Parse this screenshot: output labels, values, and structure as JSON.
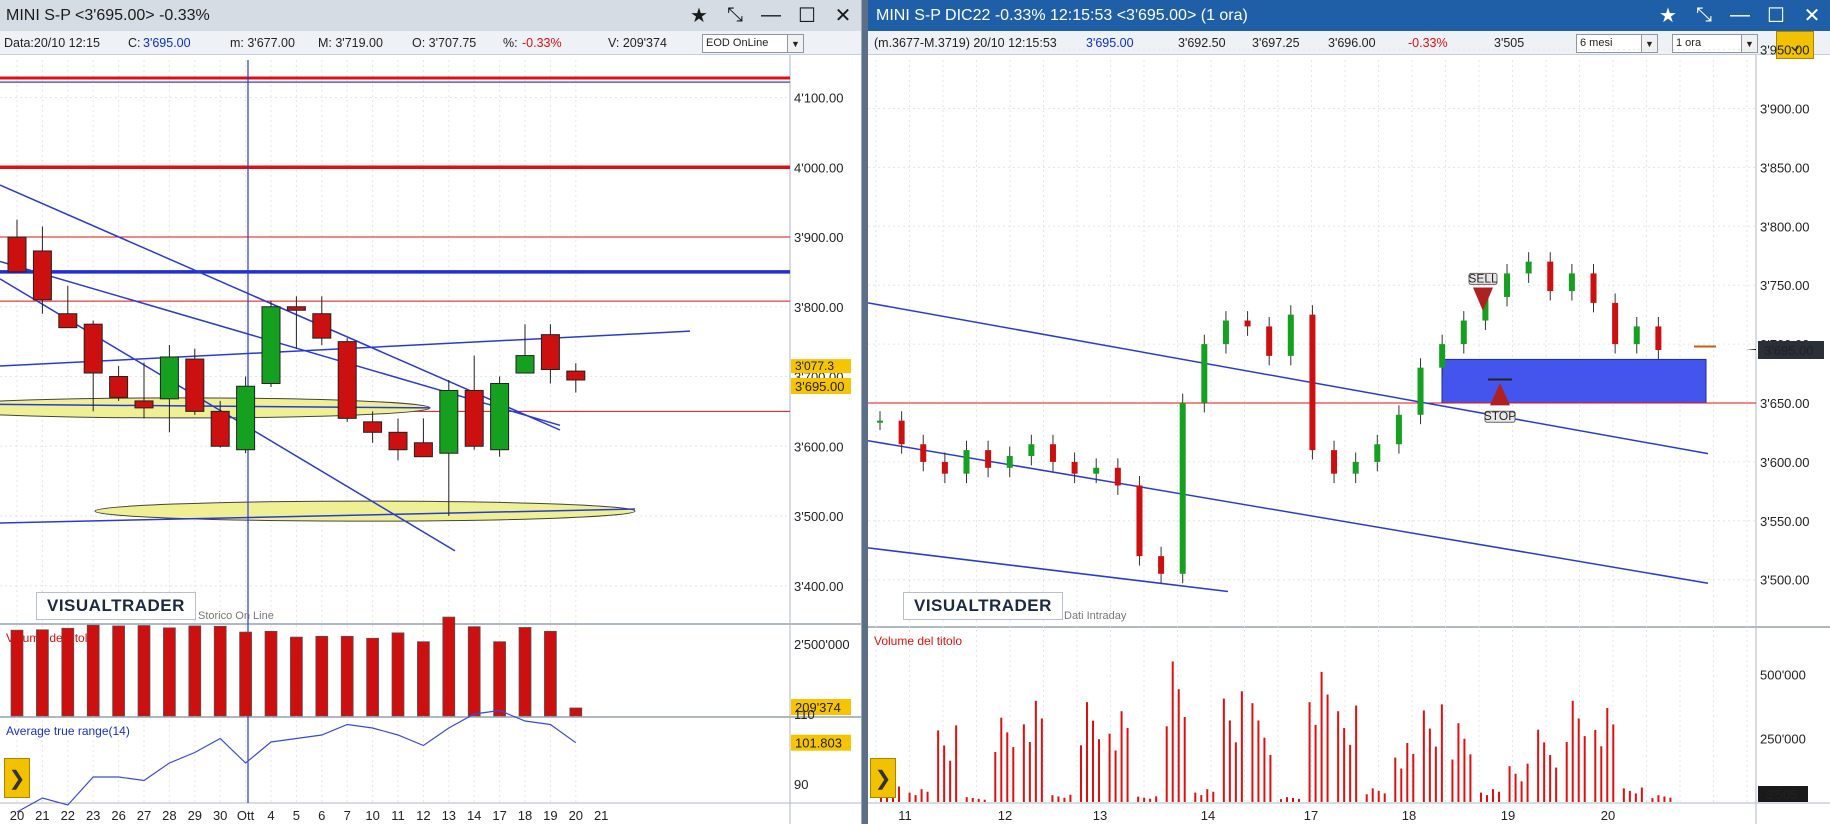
{
  "left": {
    "title": "MINI S-P <3'695.00> -0.33%",
    "info": {
      "data": "Data:20/10 12:15",
      "close_label": "C:",
      "close_value": "3'695.00",
      "min": "m: 3'677.00",
      "max": "M: 3'719.00",
      "open": "O: 3'707.75",
      "pct_label": "%:",
      "pct_value": "-0.33%",
      "volume": "V: 209'374",
      "feed_select": "EOD OnLine"
    },
    "logo": "VISUALTRADER",
    "logo_sub": "Storico On Line",
    "price_axis": [
      "4'100.00",
      "4'000.00",
      "3'900.00",
      "3'800.00",
      "3'700.00",
      "3'600.00",
      "3'500.00",
      "3'400.00"
    ],
    "price_tags": {
      "last": "3'695.00",
      "hidden": "3'077.3"
    },
    "volume_panel": {
      "title": "Volume del titolo",
      "axis": "2'500'000",
      "tag": "209'374"
    },
    "atr_panel": {
      "title": "Average true range(14)",
      "axis_top": "110",
      "axis_bottom": "90",
      "tag": "101.803"
    },
    "dates": [
      "20",
      "21",
      "22",
      "23",
      "26",
      "27",
      "28",
      "29",
      "30",
      "Ott",
      "4",
      "5",
      "6",
      "7",
      "10",
      "11",
      "12",
      "13",
      "14",
      "17",
      "18",
      "19",
      "20",
      "21"
    ]
  },
  "right": {
    "title": "MINI S-P DIC22 -0.33% 12:15:53 <3'695.00> (1 ora)",
    "info": {
      "range": "(m.3677-M.3719) 20/10 12:15:53",
      "last": "3'695.00",
      "v1": "3'692.50",
      "v2": "3'697.25",
      "v3": "3'696.00",
      "pct": "-0.33%",
      "v4": "3'505",
      "period_select": "6 mesi",
      "interval_select": "1 ora"
    },
    "logo": "VISUALTRADER",
    "logo_sub": "Dati Intraday",
    "price_axis": [
      "3'950.00",
      "3'900.00",
      "3'850.00",
      "3'800.00",
      "3'750.00",
      "3'700.00",
      "3'650.00",
      "3'600.00",
      "3'550.00",
      "3'500.00"
    ],
    "price_tag": "3'695.00",
    "sell_label": "SELL",
    "stop_label": "STOP",
    "volume_panel": {
      "title": "Volume del titolo",
      "axis_top": "500'000",
      "axis_mid": "250'000",
      "tag": "3'505"
    },
    "dates": [
      "11",
      "12",
      "13",
      "14",
      "17",
      "18",
      "19",
      "20"
    ]
  },
  "chart_data": [
    {
      "type": "candlestick",
      "series": [
        {
          "name": "candles",
          "values": [
            {
              "date": "20",
              "o": 3900,
              "h": 3925,
              "l": 3850,
              "c": 3850
            },
            {
              "date": "21",
              "o": 3880,
              "h": 3915,
              "l": 3790,
              "c": 3810
            },
            {
              "date": "22",
              "o": 3790,
              "h": 3830,
              "l": 3770,
              "c": 3770
            },
            {
              "date": "23",
              "o": 3775,
              "h": 3780,
              "l": 3650,
              "c": 3705
            },
            {
              "date": "26",
              "o": 3700,
              "h": 3715,
              "l": 3665,
              "c": 3670
            },
            {
              "date": "27",
              "o": 3665,
              "h": 3720,
              "l": 3640,
              "c": 3655
            },
            {
              "date": "28",
              "o": 3668,
              "h": 3745,
              "l": 3620,
              "c": 3728
            },
            {
              "date": "29",
              "o": 3725,
              "h": 3740,
              "l": 3645,
              "c": 3650
            },
            {
              "date": "30",
              "o": 3650,
              "h": 3665,
              "l": 3598,
              "c": 3600
            },
            {
              "date": "Ott",
              "o": 3595,
              "h": 3700,
              "l": 3590,
              "c": 3686
            },
            {
              "date": "4",
              "o": 3690,
              "h": 3808,
              "l": 3685,
              "c": 3800
            },
            {
              "date": "5",
              "o": 3800,
              "h": 3815,
              "l": 3740,
              "c": 3795
            },
            {
              "date": "6",
              "o": 3790,
              "h": 3815,
              "l": 3745,
              "c": 3755
            },
            {
              "date": "7",
              "o": 3750,
              "h": 3755,
              "l": 3635,
              "c": 3640
            },
            {
              "date": "10",
              "o": 3635,
              "h": 3650,
              "l": 3605,
              "c": 3620
            },
            {
              "date": "11",
              "o": 3620,
              "h": 3640,
              "l": 3580,
              "c": 3595
            },
            {
              "date": "12",
              "o": 3605,
              "h": 3640,
              "l": 3590,
              "c": 3585
            },
            {
              "date": "13",
              "o": 3590,
              "h": 3695,
              "l": 3500,
              "c": 3680
            },
            {
              "date": "14",
              "o": 3680,
              "h": 3730,
              "l": 3595,
              "c": 3600
            },
            {
              "date": "17",
              "o": 3595,
              "h": 3700,
              "l": 3585,
              "c": 3690
            },
            {
              "date": "18",
              "o": 3705,
              "h": 3775,
              "l": 3705,
              "c": 3730
            },
            {
              "date": "19",
              "o": 3760,
              "h": 3775,
              "l": 3690,
              "c": 3710
            },
            {
              "date": "20",
              "o": 3707.75,
              "h": 3719,
              "l": 3677,
              "c": 3695
            }
          ]
        },
        {
          "name": "Volume del titolo",
          "values": [
            2230000,
            2240000,
            2280000,
            2360000,
            2340000,
            2350000,
            2290000,
            2340000,
            2330000,
            2180000,
            2200000,
            2050000,
            2070000,
            2070000,
            2020000,
            2160000,
            1930000,
            2570000,
            2320000,
            1930000,
            2300000,
            2200000,
            209374
          ]
        },
        {
          "name": "Average true range(14)",
          "values": [
            82,
            86,
            84,
            92,
            92,
            91,
            96,
            99,
            103,
            96,
            102,
            103,
            104,
            107,
            106,
            104,
            101,
            106,
            110,
            111,
            108,
            107,
            101.803
          ]
        }
      ],
      "ylim": [
        3350,
        4140
      ]
    },
    {
      "type": "line",
      "series": [
        {
          "name": "price",
          "values": [
            3635,
            3615,
            3600,
            3590,
            3610,
            3595,
            3605,
            3615,
            3600,
            3590,
            3595,
            3580,
            3520,
            3505,
            3650,
            3700,
            3720,
            3715,
            3690,
            3725,
            3610,
            3590,
            3600,
            3615,
            3640,
            3680,
            3700,
            3720,
            3740,
            3760,
            3770,
            3745,
            3760,
            3735,
            3700,
            3715,
            3695
          ]
        },
        {
          "name": "Volume del titolo",
          "values": [
            120000,
            60000,
            360000,
            20000,
            350000,
            420000,
            30000,
            440000,
            400000,
            25000,
            660000,
            60000,
            520000,
            410000,
            20000,
            540000,
            400000,
            60000,
            260000,
            430000,
            370000,
            60000,
            180000,
            300000,
            420000,
            390000,
            60000,
            30000
          ]
        }
      ],
      "ylim": [
        3490,
        3960
      ]
    }
  ]
}
